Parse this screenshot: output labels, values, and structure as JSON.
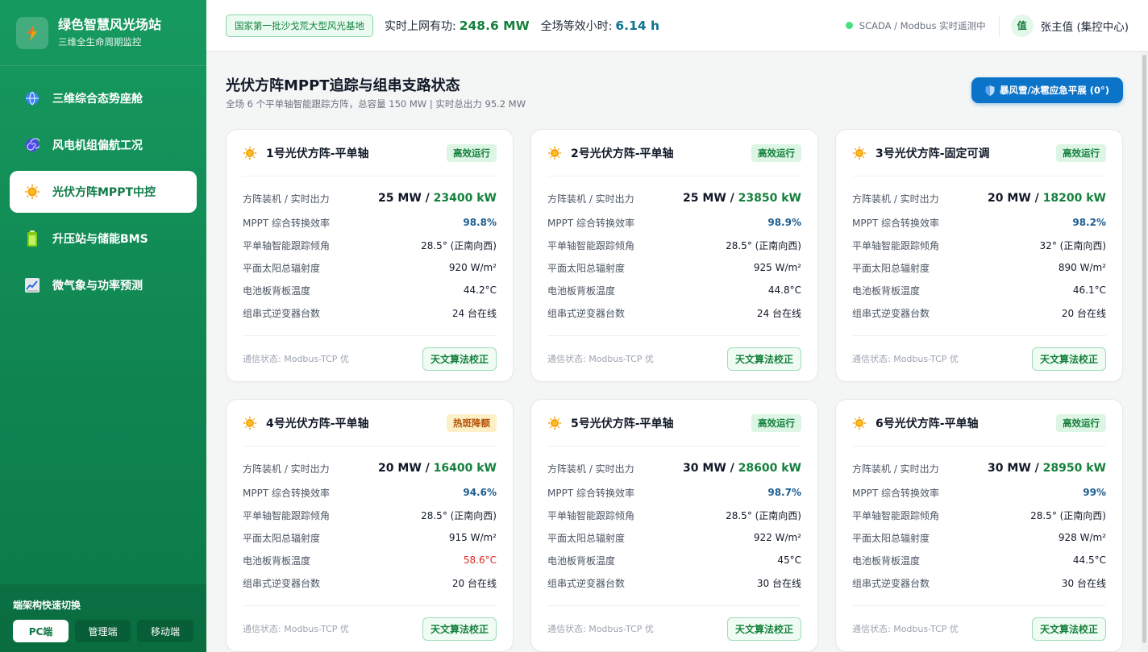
{
  "brand": {
    "title": "绿色智慧风光场站",
    "subtitle": "三维全生命周期监控",
    "logo_icon": "lightning-icon"
  },
  "nav": [
    {
      "label": "三维综合态势座舱",
      "icon": "globe-icon",
      "active": false
    },
    {
      "label": "风电机组偏航工况",
      "icon": "spiral-icon",
      "active": false
    },
    {
      "label": "光伏方阵MPPT中控",
      "icon": "sun-icon",
      "active": true
    },
    {
      "label": "升压站与储能BMS",
      "icon": "battery-icon",
      "active": false
    },
    {
      "label": "微气象与功率预测",
      "icon": "chart-icon",
      "active": false
    }
  ],
  "switcher": {
    "title": "端架构快速切换",
    "buttons": [
      "PC端",
      "管理端",
      "移动端"
    ],
    "active": "PC端"
  },
  "header": {
    "base_badge": "国家第一批沙戈荒大型风光基地",
    "power_label": "实时上网有功:",
    "power_value": "248.6 MW",
    "hours_label": "全场等效小时:",
    "hours_value": "6.14 h",
    "status_text": "SCADA / Modbus 实时遥测中",
    "avatar_text": "值",
    "user_name": "张主值 (集控中心)"
  },
  "page": {
    "title": "光伏方阵MPPT追踪与组串支路状态",
    "subtitle": "全场 6 个平单轴智能跟踪方阵，总容量 150 MW | 实时总出力 95.2 MW",
    "emergency_button": "暴风雪/冰雹应急平展 (0°)"
  },
  "labels": {
    "power": "方阵装机 / 实时出力",
    "efficiency": "MPPT 综合转换效率",
    "tilt": "平单轴智能跟踪倾角",
    "irradiance": "平面太阳总辐射度",
    "temp": "电池板背板温度",
    "inverters": "组串式逆变器台数",
    "comm": "通信状态: Modbus-TCP 优",
    "calibrate": "天文算法校正"
  },
  "colors": {
    "accent": "#0f8451",
    "ok": "#15803d",
    "warn": "#b45309",
    "alert": "#dc2626",
    "emergency": "#0b74c9"
  },
  "arrays": [
    {
      "name": "1号光伏方阵-平单轴",
      "status": "高效运行",
      "status_level": "ok",
      "capacity": "25 MW",
      "output": "23400 kW",
      "efficiency": "98.8%",
      "tilt": "28.5° (正南向西)",
      "irradiance": "920 W/m²",
      "temp": "44.2°C",
      "temp_alert": false,
      "inverters": "24 台在线"
    },
    {
      "name": "2号光伏方阵-平单轴",
      "status": "高效运行",
      "status_level": "ok",
      "capacity": "25 MW",
      "output": "23850 kW",
      "efficiency": "98.9%",
      "tilt": "28.5° (正南向西)",
      "irradiance": "925 W/m²",
      "temp": "44.8°C",
      "temp_alert": false,
      "inverters": "24 台在线"
    },
    {
      "name": "3号光伏方阵-固定可调",
      "status": "高效运行",
      "status_level": "ok",
      "capacity": "20 MW",
      "output": "18200 kW",
      "efficiency": "98.2%",
      "tilt": "32° (正南向西)",
      "irradiance": "890 W/m²",
      "temp": "46.1°C",
      "temp_alert": false,
      "inverters": "20 台在线"
    },
    {
      "name": "4号光伏方阵-平单轴",
      "status": "热斑降额",
      "status_level": "warn",
      "capacity": "20 MW",
      "output": "16400 kW",
      "efficiency": "94.6%",
      "tilt": "28.5° (正南向西)",
      "irradiance": "915 W/m²",
      "temp": "58.6°C",
      "temp_alert": true,
      "inverters": "20 台在线"
    },
    {
      "name": "5号光伏方阵-平单轴",
      "status": "高效运行",
      "status_level": "ok",
      "capacity": "30 MW",
      "output": "28600 kW",
      "efficiency": "98.7%",
      "tilt": "28.5° (正南向西)",
      "irradiance": "922 W/m²",
      "temp": "45°C",
      "temp_alert": false,
      "inverters": "30 台在线"
    },
    {
      "name": "6号光伏方阵-平单轴",
      "status": "高效运行",
      "status_level": "ok",
      "capacity": "30 MW",
      "output": "28950 kW",
      "efficiency": "99%",
      "tilt": "28.5° (正南向西)",
      "irradiance": "928 W/m²",
      "temp": "44.5°C",
      "temp_alert": false,
      "inverters": "30 台在线"
    }
  ]
}
